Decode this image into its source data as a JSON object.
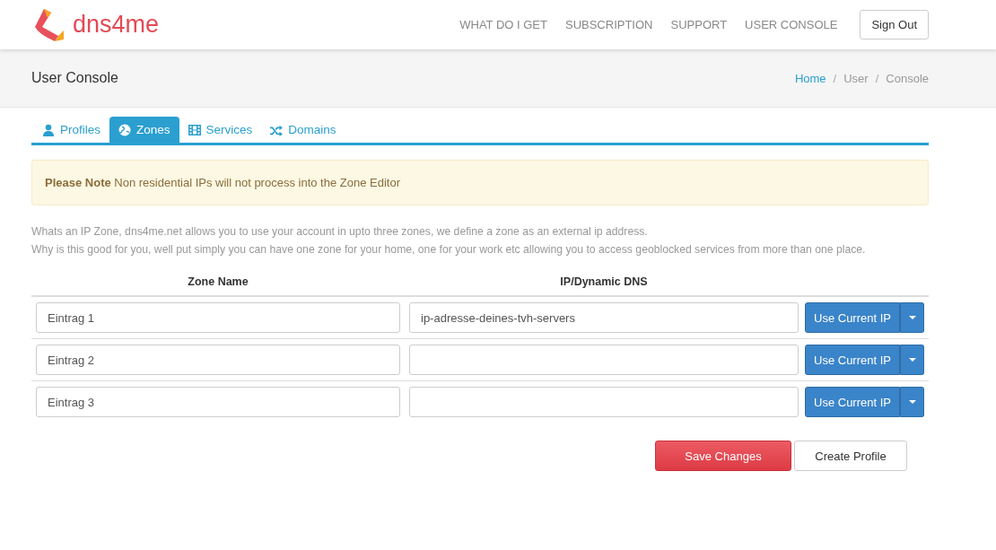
{
  "header": {
    "logo_text": "dns4me",
    "nav": [
      "WHAT DO I GET",
      "SUBSCRIPTION",
      "SUPPORT",
      "USER CONSOLE"
    ],
    "sign_out": "Sign Out"
  },
  "page_title": "User Console",
  "breadcrumb": [
    {
      "label": "Home",
      "link": true
    },
    {
      "separator": "/"
    },
    {
      "label": "User",
      "link": false
    },
    {
      "separator": "/"
    },
    {
      "label": "Console",
      "link": false
    }
  ],
  "tabs": [
    {
      "label": "Profiles",
      "kind": "person",
      "selected": false
    },
    {
      "label": "Zones",
      "kind": "globe",
      "selected": true
    },
    {
      "label": "Services",
      "kind": "film",
      "selected": false
    },
    {
      "label": "Domains",
      "kind": "shuffle",
      "selected": false
    }
  ],
  "alert": "**Please Note** Non residential IPs will not process into the Zone Editor",
  "intro": [
    "Whats an IP Zone, dns4me.net allows you to use your account in upto three zones, we define a zone as an external ip address.",
    "Why is this good for you, well put simply you can have one zone for your home, one for your work etc allowing you to access geoblocked services from more than one place."
  ],
  "table": {
    "columns": [
      "Zone Name",
      "IP/Dynamic DNS"
    ],
    "rows": [
      {
        "zone_name": "Eintrag 1",
        "ip": "ip-adresse-deines-tvh-servers",
        "button": "Use Current IP"
      },
      {
        "zone_name": "Eintrag 2",
        "button": "Use Current IP"
      },
      {
        "zone_name": "Eintrag 3",
        "button": "Use Current IP"
      }
    ]
  },
  "actions": {
    "save": "Save Changes",
    "create": "Create Profile"
  }
}
